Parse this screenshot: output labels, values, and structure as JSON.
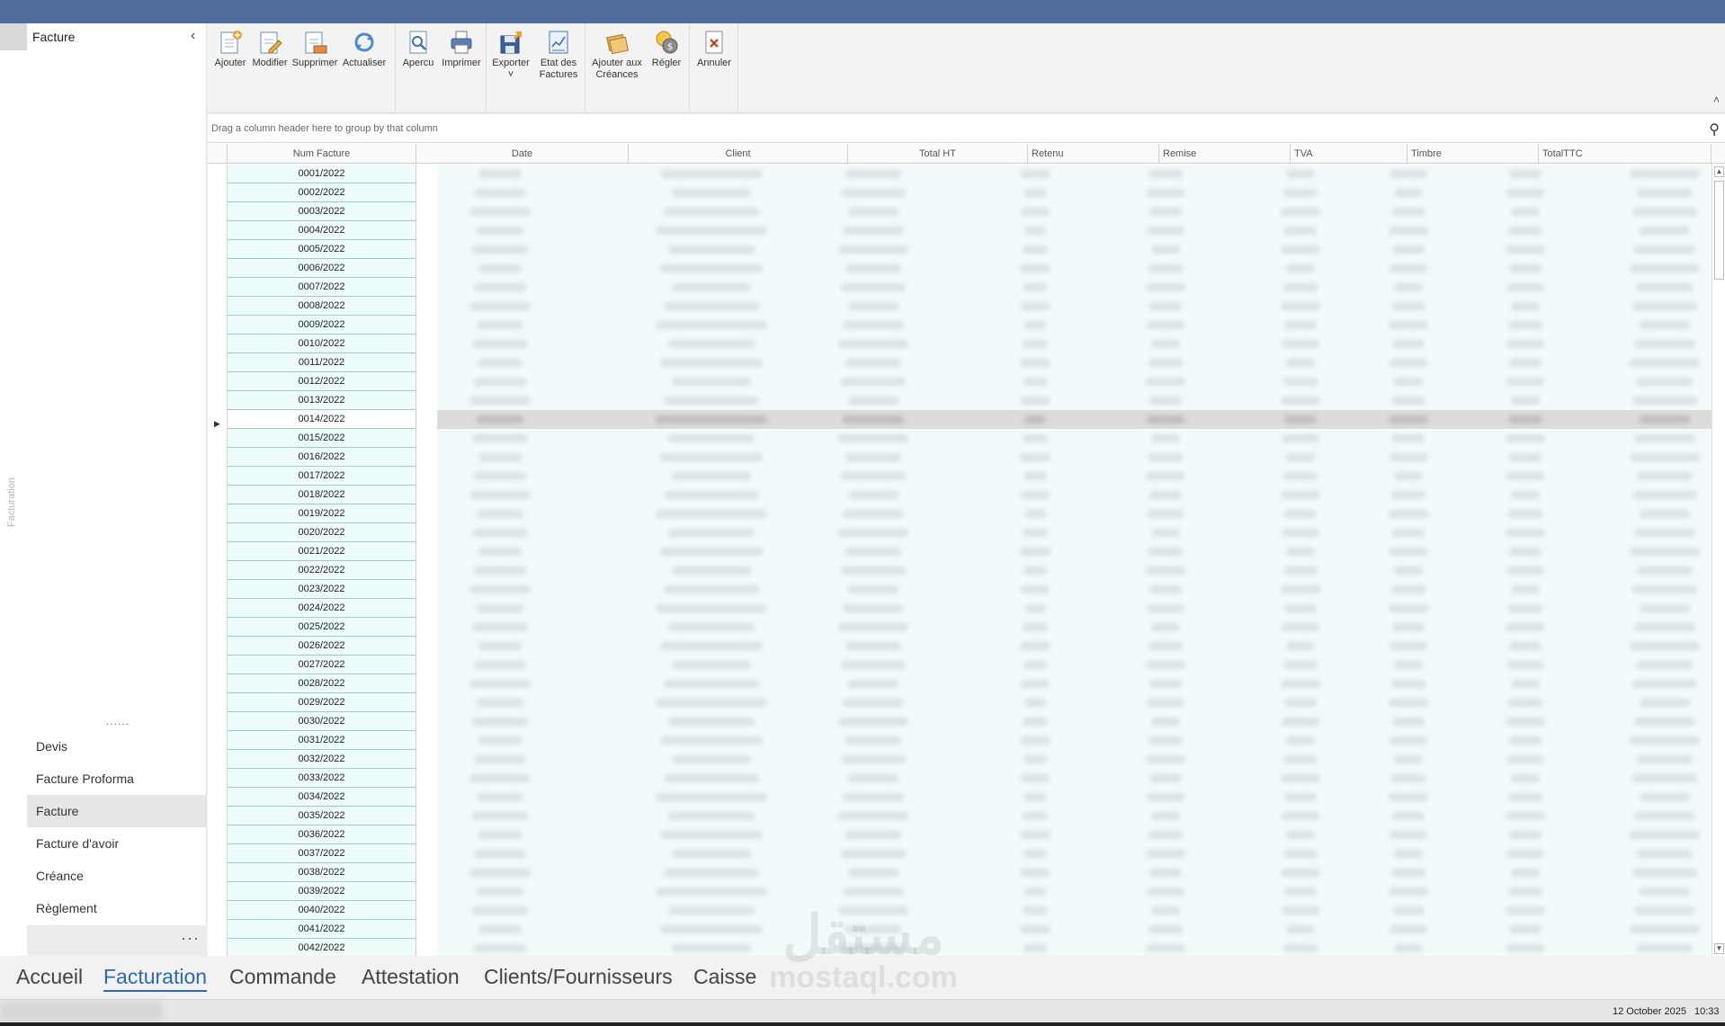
{
  "nav": {
    "header_title": "Facture",
    "collapse_glyph": "‹",
    "vertical_label": "Facturation",
    "dots_top": "......",
    "items": [
      {
        "label": "Devis"
      },
      {
        "label": "Facture Proforma"
      },
      {
        "label": "Facture"
      },
      {
        "label": "Facture d'avoir"
      },
      {
        "label": "Créance"
      },
      {
        "label": "Règlement"
      }
    ],
    "active_item": "Facture",
    "more_glyph": "···"
  },
  "ribbon": {
    "buttons": {
      "ajouter": "Ajouter",
      "modifier": "Modifier",
      "supprimer": "Supprimer",
      "actualiser": "Actualiser",
      "apercu": "Apercu",
      "imprimer": "Imprimer",
      "exporter": "Exporter",
      "exporter_arrow": "˅",
      "etat_line1": "Etat des",
      "etat_line2": "Factures",
      "creances_line1": "Ajouter aux",
      "creances_line2": "Créances",
      "regler": "Régler",
      "annuler": "Annuler"
    },
    "icons": [
      "add-document-icon",
      "edit-document-icon",
      "delete-document-icon",
      "refresh-icon",
      "preview-icon",
      "printer-icon",
      "export-icon",
      "report-icon",
      "receivables-icon",
      "payment-coin-icon",
      "cancel-document-icon"
    ],
    "collapse_glyph": "˄"
  },
  "grid": {
    "group_hint": "Drag a column header here to group by that column",
    "search_icon": "search-icon",
    "columns": [
      "Num Facture",
      "Date",
      "Client",
      "Total HT",
      "Retenu",
      "Remise",
      "TVA",
      "Timbre",
      "TotalTTC"
    ],
    "invoice_numbers": [
      "0001/2022",
      "0002/2022",
      "0003/2022",
      "0004/2022",
      "0005/2022",
      "0006/2022",
      "0007/2022",
      "0008/2022",
      "0009/2022",
      "0010/2022",
      "0011/2022",
      "0012/2022",
      "0013/2022",
      "0014/2022",
      "0015/2022",
      "0016/2022",
      "0017/2022",
      "0018/2022",
      "0019/2022",
      "0020/2022",
      "0021/2022",
      "0022/2022",
      "0023/2022",
      "0024/2022",
      "0025/2022",
      "0026/2022",
      "0027/2022",
      "0028/2022",
      "0029/2022",
      "0030/2022",
      "0031/2022",
      "0032/2022",
      "0033/2022",
      "0034/2022",
      "0035/2022",
      "0036/2022",
      "0037/2022",
      "0038/2022",
      "0039/2022",
      "0040/2022",
      "0041/2022",
      "0042/2022"
    ],
    "selected_invoice": "0014/2022",
    "row_indicator_glyph": "▶"
  },
  "tabs": [
    {
      "label": "Accueil"
    },
    {
      "label": "Facturation"
    },
    {
      "label": "Commande"
    },
    {
      "label": "Attestation"
    },
    {
      "label": "Clients/Fournisseurs"
    },
    {
      "label": "Caisse"
    }
  ],
  "active_tab": "Facturation",
  "watermark": {
    "arabic": "مستقل",
    "latin": "mostaql.com"
  },
  "status": {
    "date": "12 October 2025",
    "time": "10:33"
  },
  "colors": {
    "titlebar": "#4f6c9f",
    "accent": "#2b6bb0",
    "grid_row": "#effcfc",
    "grid_row_border": "#9bc9c6"
  }
}
